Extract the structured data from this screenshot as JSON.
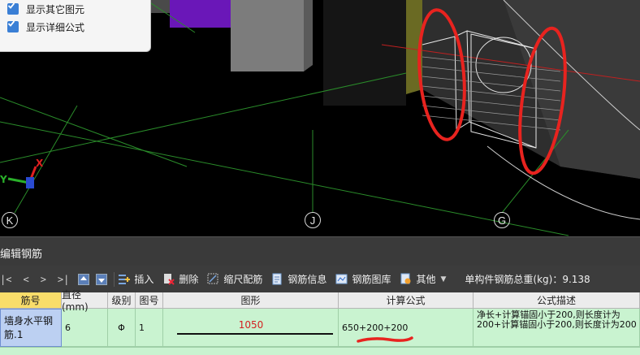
{
  "options": {
    "show_other_elements": "显示其它图元",
    "show_detailed_formula": "显示详细公式"
  },
  "axes": {
    "k": "K",
    "j": "J",
    "g": "G",
    "x": "X",
    "y": "Y"
  },
  "panel": {
    "title": "编辑钢筋"
  },
  "toolbar": {
    "first": "|<",
    "prev": "<",
    "next": ">",
    "last": ">|",
    "insert": "插入",
    "delete": "删除",
    "scale_rebar": "缩尺配筋",
    "rebar_info": "钢筋信息",
    "rebar_library": "钢筋图库",
    "other": "其他",
    "total_weight": "单构件钢筋总重(kg)：9.138"
  },
  "table": {
    "headers": [
      "筋号",
      "直径(mm)",
      "级别",
      "图号",
      "图形",
      "计算公式",
      "公式描述"
    ],
    "rows": [
      {
        "bar_no": "墙身水平钢筋.1",
        "diameter": "6",
        "grade": "Φ",
        "shape_no": "1",
        "shape_length": "1050",
        "formula": "650+200+200",
        "description": "净长+计算锚固小于200,则长度计为200+计算锚固小于200,则长度计为200"
      }
    ]
  },
  "colors": {
    "annotation": "#e8231f",
    "header_active": "#f9dd6a",
    "grid_bg": "#c9f3d0",
    "checkbox": "#3a7fd5"
  }
}
